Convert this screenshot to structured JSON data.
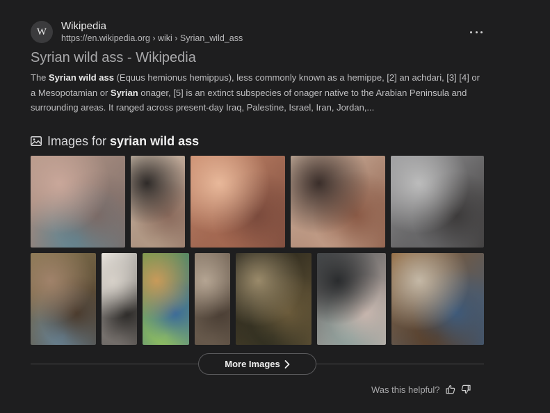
{
  "result": {
    "favicon_letter": "W",
    "site_name": "Wikipedia",
    "url": "https://en.wikipedia.org › wiki › Syrian_wild_ass",
    "title": "Syrian wild ass - Wikipedia",
    "snippet": {
      "p1": "The ",
      "b1": "Syrian wild ass",
      "p2": " (Equus hemionus hemippus), less commonly known as a hemippe, [2] an achdari, [3] [4] or a Mesopotamian or ",
      "b2": "Syrian",
      "p3": " onager, [5] is an extinct subspecies of onager native to the Arabian Peninsula and surrounding areas. It ranged across present-day Iraq, Palestine, Israel, Iran, Jordan,..."
    }
  },
  "images_section": {
    "label": "Images for",
    "query": "syrian wild ass",
    "thumbnails": [
      {
        "name": "image-thumbnail-1",
        "colors": [
          "#b89a8a",
          "#7a6a66",
          "#c9a79a",
          "#5d8a9a"
        ]
      },
      {
        "name": "image-thumbnail-2",
        "colors": [
          "#d8c8b6",
          "#8a6a5c",
          "#2e2a28",
          "#b59d88"
        ]
      },
      {
        "name": "image-thumbnail-3",
        "colors": [
          "#c98a6c",
          "#7a4a3c",
          "#e8b89a",
          "#a86a52"
        ]
      },
      {
        "name": "image-thumbnail-4",
        "colors": [
          "#d8c0ac",
          "#8a5a46",
          "#3a2e2a",
          "#c8a48e"
        ]
      },
      {
        "name": "image-thumbnail-5",
        "colors": [
          "#9a9a9c",
          "#3c3a3a",
          "#bcbcbc",
          "#6a6a6c"
        ]
      },
      {
        "name": "image-thumbnail-6",
        "colors": [
          "#8a7a52",
          "#4a3a2c",
          "#a0826a",
          "#6a8aa0"
        ]
      },
      {
        "name": "image-thumbnail-7",
        "colors": [
          "#f0ece6",
          "#2a2826",
          "#d6d0c8",
          "#7a7470"
        ]
      },
      {
        "name": "image-thumbnail-8",
        "colors": [
          "#6a9a4a",
          "#3a6a9a",
          "#c89a5a",
          "#9ac85a"
        ]
      },
      {
        "name": "image-thumbnail-9",
        "colors": [
          "#8a7a6a",
          "#4a3e34",
          "#b4a492",
          "#6a5c4e"
        ]
      },
      {
        "name": "image-thumbnail-10",
        "colors": [
          "#1a1a14",
          "#6a5a3a",
          "#9a8a6a",
          "#2a2a1e"
        ]
      },
      {
        "name": "image-thumbnail-11",
        "colors": [
          "#4a4e50",
          "#c8b6ae",
          "#2a2c2e",
          "#8aa09c"
        ]
      },
      {
        "name": "image-thumbnail-12",
        "colors": [
          "#8a5a2a",
          "#3e5a7a",
          "#c4b8a6",
          "#5a3a1e"
        ]
      }
    ]
  },
  "more_images_label": "More Images",
  "feedback": {
    "label": "Was this helpful?"
  }
}
